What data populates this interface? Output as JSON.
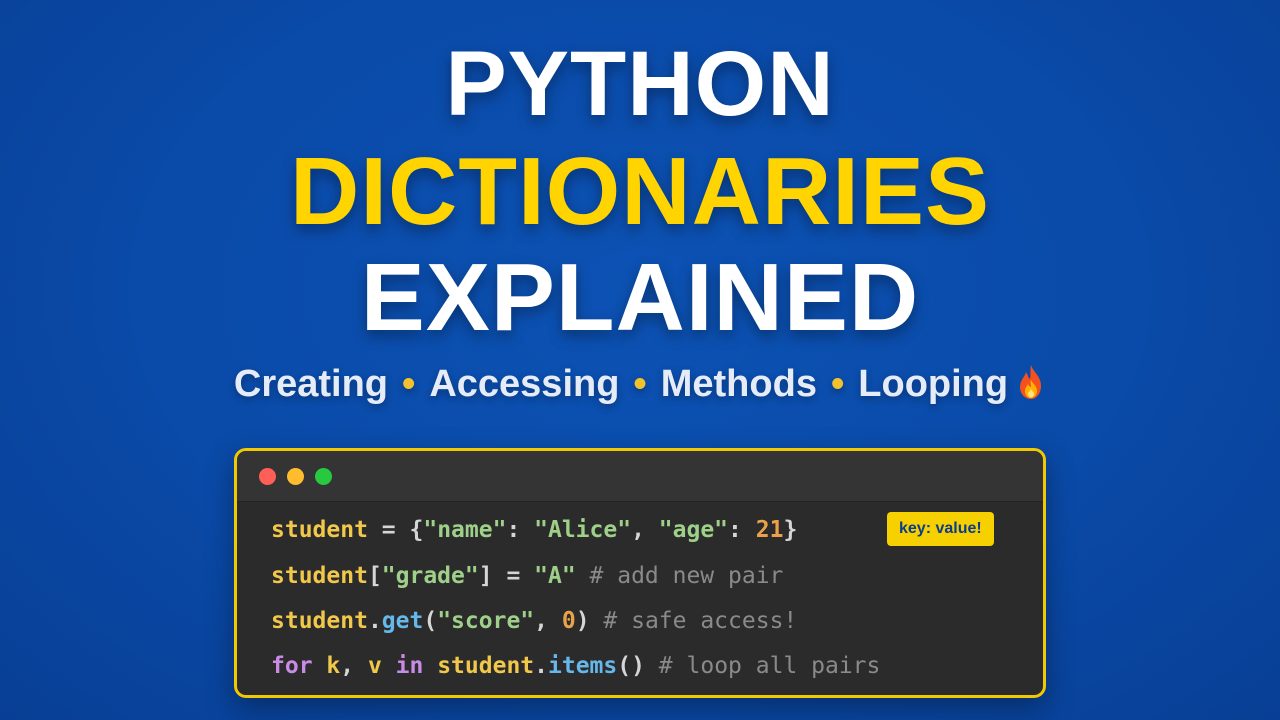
{
  "title": {
    "line1": "PYTHON",
    "line2": "DICTIONARIES",
    "line3": "EXPLAINED"
  },
  "subtitle": {
    "items": [
      "Creating",
      "Accessing",
      "Methods",
      "Looping"
    ],
    "separator": "•",
    "emoji_icon": "flame-icon"
  },
  "code_window": {
    "badge": "key: value!",
    "lines": [
      [
        {
          "t": "student",
          "c": "var"
        },
        {
          "t": " = ",
          "c": "op"
        },
        {
          "t": "{",
          "c": "op"
        },
        {
          "t": "\"name\"",
          "c": "str"
        },
        {
          "t": ": ",
          "c": "op"
        },
        {
          "t": "\"Alice\"",
          "c": "str"
        },
        {
          "t": ", ",
          "c": "op"
        },
        {
          "t": "\"age\"",
          "c": "str"
        },
        {
          "t": ": ",
          "c": "op"
        },
        {
          "t": "21",
          "c": "num"
        },
        {
          "t": "}",
          "c": "op"
        }
      ],
      [
        {
          "t": "student",
          "c": "var"
        },
        {
          "t": "[",
          "c": "op"
        },
        {
          "t": "\"grade\"",
          "c": "str"
        },
        {
          "t": "]",
          "c": "op"
        },
        {
          "t": " = ",
          "c": "op"
        },
        {
          "t": "\"A\"",
          "c": "str"
        },
        {
          "t": " # add new pair",
          "c": "cmt"
        }
      ],
      [
        {
          "t": "student",
          "c": "var"
        },
        {
          "t": ".",
          "c": "op"
        },
        {
          "t": "get",
          "c": "fn"
        },
        {
          "t": "(",
          "c": "op"
        },
        {
          "t": "\"score\"",
          "c": "str"
        },
        {
          "t": ", ",
          "c": "op"
        },
        {
          "t": "0",
          "c": "num"
        },
        {
          "t": ")",
          "c": "op"
        },
        {
          "t": " # safe access!",
          "c": "cmt"
        }
      ],
      [
        {
          "t": "for",
          "c": "kw"
        },
        {
          "t": " k",
          "c": "var"
        },
        {
          "t": ", ",
          "c": "op"
        },
        {
          "t": "v",
          "c": "var"
        },
        {
          "t": " in ",
          "c": "kw"
        },
        {
          "t": "student",
          "c": "var"
        },
        {
          "t": ".",
          "c": "op"
        },
        {
          "t": "items",
          "c": "fn"
        },
        {
          "t": "()",
          "c": "op"
        },
        {
          "t": " # loop all pairs",
          "c": "cmt"
        }
      ]
    ]
  },
  "colors": {
    "background": "#0a4aa8",
    "accent_yellow": "#ffd400",
    "editor_bg": "#2b2b2c",
    "editor_border": "#f2c800"
  }
}
